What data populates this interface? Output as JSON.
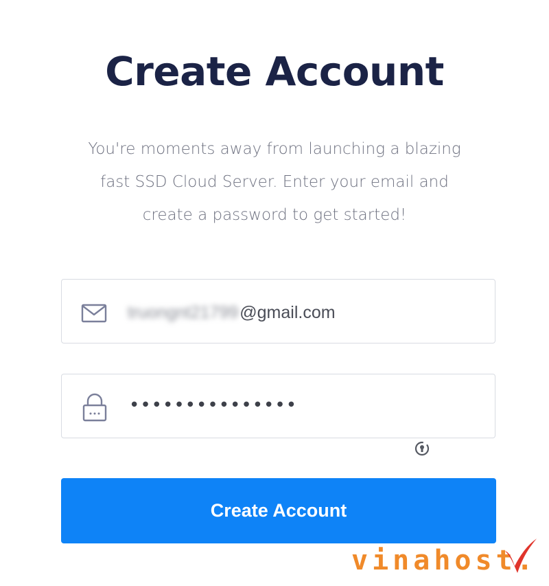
{
  "form": {
    "title": "Create Account",
    "subtitle_lines": [
      "You're moments away from launching a blazing",
      "fast SSD Cloud Server. Enter your email and",
      "create a password to get started!"
    ],
    "email": {
      "icon": "envelope-icon",
      "value_local_blurred": "truongnt21799",
      "value_domain": "@gmail.com"
    },
    "password": {
      "icon": "lock-icon",
      "value_masked": "•••••••••••••••"
    },
    "password_manager_icon": "key-manager-icon",
    "submit_label": "Create Account"
  },
  "watermark": {
    "text": "vinahost.",
    "icon": "check-mark-icon"
  },
  "colors": {
    "title": "#1b2346",
    "subtitle": "#6e7180",
    "button": "#0e83f7",
    "border": "#d8dbe2",
    "icon": "#7a7f9a",
    "watermark_orange": "#f08a2a",
    "watermark_red": "#e0342b"
  }
}
